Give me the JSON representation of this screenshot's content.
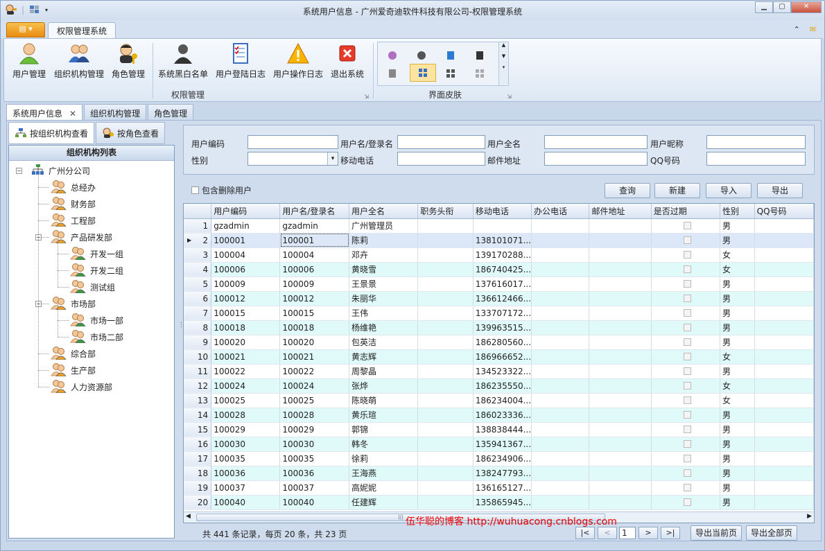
{
  "window": {
    "title": "系统用户信息 - 广州爱奇迪软件科技有限公司-权限管理系统"
  },
  "ribbon": {
    "tab": "权限管理系统",
    "groups": [
      {
        "label": "权限管理"
      },
      {
        "label": "界面皮肤"
      }
    ],
    "buttons": [
      {
        "label": "用户管理",
        "icon": "user-icon"
      },
      {
        "label": "组织机构管理",
        "icon": "organization-icon"
      },
      {
        "label": "角色管理",
        "icon": "role-key-icon"
      },
      {
        "label": "系统黑白名单",
        "icon": "blacklist-user-icon"
      },
      {
        "label": "用户登陆日志",
        "icon": "login-log-icon"
      },
      {
        "label": "用户操作日志",
        "icon": "warning-icon"
      },
      {
        "label": "退出系统",
        "icon": "exit-icon"
      }
    ]
  },
  "doc_tabs": [
    {
      "label": "系统用户信息"
    },
    {
      "label": "组织机构管理"
    },
    {
      "label": "角色管理"
    }
  ],
  "left": {
    "tabs": [
      {
        "label": "按组织机构查看"
      },
      {
        "label": "按角色查看"
      }
    ],
    "tree_title": "组织机构列表",
    "nodes": [
      {
        "label": "广州分公司"
      },
      {
        "label": "总经办"
      },
      {
        "label": "财务部"
      },
      {
        "label": "工程部"
      },
      {
        "label": "产品研发部"
      },
      {
        "label": "开发一组"
      },
      {
        "label": "开发二组"
      },
      {
        "label": "测试组"
      },
      {
        "label": "市场部"
      },
      {
        "label": "市场一部"
      },
      {
        "label": "市场二部"
      },
      {
        "label": "综合部"
      },
      {
        "label": "生产部"
      },
      {
        "label": "人力资源部"
      }
    ]
  },
  "filter": {
    "labels": {
      "code": "用户编码",
      "login": "用户名/登录名",
      "fullname": "用户全名",
      "nickname": "用户昵称",
      "gender": "性别",
      "mobile": "移动电话",
      "email": "邮件地址",
      "qq": "QQ号码"
    },
    "include_deleted": "包含删除用户"
  },
  "actions": {
    "query": "查询",
    "new": "新建",
    "import": "导入",
    "export": "导出"
  },
  "table": {
    "columns": [
      "用户编码",
      "用户名/登录名",
      "用户全名",
      "职务头衔",
      "移动电话",
      "办公电话",
      "邮件地址",
      "是否过期",
      "性别",
      "QQ号码"
    ],
    "rows": [
      [
        "1",
        "gzadmin",
        "gzadmin",
        "广州管理员",
        "",
        "",
        "男"
      ],
      [
        "2",
        "100001",
        "100001",
        "陈莉",
        "138101071...",
        "",
        "男"
      ],
      [
        "3",
        "100004",
        "100004",
        "邓卉",
        "139170288...",
        "",
        "女"
      ],
      [
        "4",
        "100006",
        "100006",
        "黄晓雪",
        "186740425...",
        "",
        "女"
      ],
      [
        "5",
        "100009",
        "100009",
        "王景景",
        "137616017...",
        "",
        "男"
      ],
      [
        "6",
        "100012",
        "100012",
        "朱丽华",
        "136612466...",
        "",
        "男"
      ],
      [
        "7",
        "100015",
        "100015",
        "王伟",
        "133707172...",
        "",
        "男"
      ],
      [
        "8",
        "100018",
        "100018",
        "杨维艳",
        "139963515...",
        "",
        "男"
      ],
      [
        "9",
        "100020",
        "100020",
        "包英洁",
        "186280560...",
        "",
        "男"
      ],
      [
        "10",
        "100021",
        "100021",
        "黄志辉",
        "186966652...",
        "",
        "女"
      ],
      [
        "11",
        "100022",
        "100022",
        "周黎晶",
        "134523322...",
        "",
        "男"
      ],
      [
        "12",
        "100024",
        "100024",
        "张烨",
        "186235550...",
        "",
        "女"
      ],
      [
        "13",
        "100025",
        "100025",
        "陈晓萌",
        "186234004...",
        "",
        "女"
      ],
      [
        "14",
        "100028",
        "100028",
        "黄乐瑄",
        "186023336...",
        "",
        "男"
      ],
      [
        "15",
        "100029",
        "100029",
        "郭锦",
        "138838444...",
        "",
        "男"
      ],
      [
        "16",
        "100030",
        "100030",
        "韩冬",
        "135941367...",
        "",
        "男"
      ],
      [
        "17",
        "100035",
        "100035",
        "徐莉",
        "186234906...",
        "",
        "男"
      ],
      [
        "18",
        "100036",
        "100036",
        "王海燕",
        "138247793...",
        "",
        "男"
      ],
      [
        "19",
        "100037",
        "100037",
        "高妮妮",
        "136165127...",
        "",
        "男"
      ],
      [
        "20",
        "100040",
        "100040",
        "任建辉",
        "135865945...",
        "",
        "男"
      ]
    ],
    "selected_row": 2
  },
  "pager": {
    "info": "共 441 条记录，每页 20 条，共 23 页",
    "page": "1",
    "first": "|<",
    "prev": "<",
    "next": ">",
    "last": ">|",
    "export_current": "导出当前页",
    "export_all": "导出全部页"
  },
  "watermark": "伍华聪的博客 http://wuhuacong.cnblogs.com"
}
